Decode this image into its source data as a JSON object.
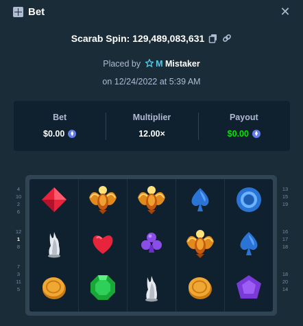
{
  "header": {
    "title": "Bet",
    "close_label": "✕"
  },
  "spin": {
    "label": "Scarab Spin: 129,489,083,631"
  },
  "placed": {
    "prefix": "Placed by",
    "vip_badge": "M",
    "user": "Mistaker"
  },
  "date": {
    "text": "on 12/24/2022 at 5:39 AM"
  },
  "stats": {
    "bet": {
      "label": "Bet",
      "value": "$0.00"
    },
    "multiplier": {
      "label": "Multiplier",
      "value": "12.00×"
    },
    "payout": {
      "label": "Payout",
      "value": "$0.00"
    }
  },
  "colors": {
    "payout": "#00e701",
    "background": "#1a2c38",
    "panel": "#0f212e"
  },
  "paylines": {
    "left": [
      [
        "4",
        "10",
        "2",
        "6"
      ],
      [
        "12",
        "1",
        "8"
      ],
      [
        "7",
        "3",
        "11",
        "5"
      ]
    ],
    "right": [
      [
        "13",
        "15",
        "19"
      ],
      [
        "16",
        "17",
        "18"
      ],
      [
        "18",
        "20",
        "14"
      ]
    ],
    "left_active": "1"
  },
  "board": {
    "rows": [
      [
        "red-diamond-icon",
        "scarab-icon",
        "scarab-icon",
        "blue-spade-icon",
        "blue-ring-icon"
      ],
      [
        "white-cat-statue-icon",
        "red-heart-icon",
        "purple-club-icon",
        "scarab-icon",
        "blue-spade-icon"
      ],
      [
        "gold-coin-icon",
        "green-emerald-icon",
        "white-cat-statue-icon",
        "gold-coin-icon",
        "purple-pentagon-icon"
      ]
    ]
  }
}
